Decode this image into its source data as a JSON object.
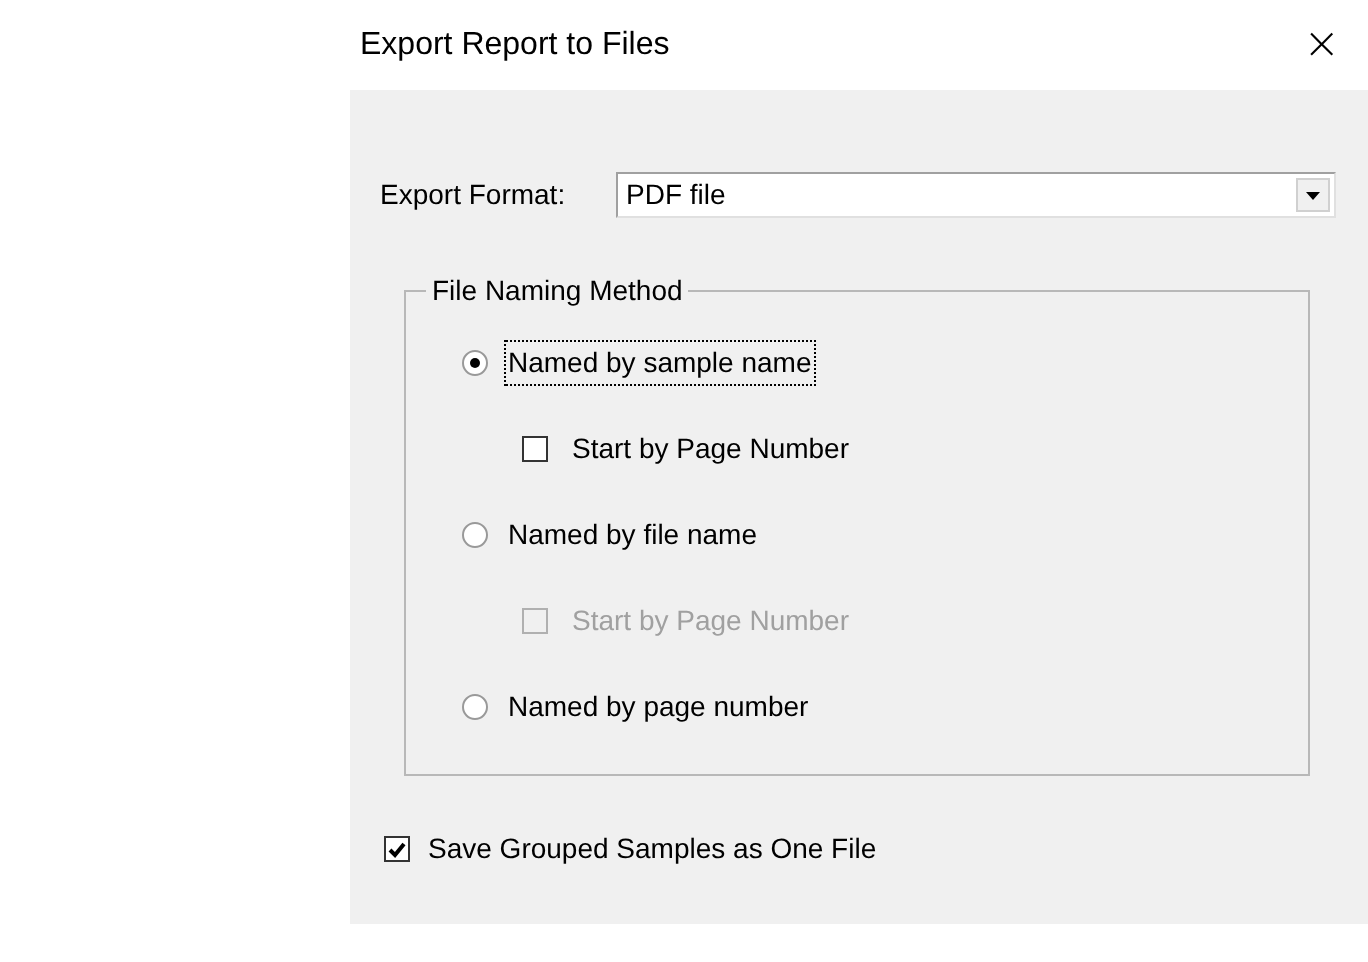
{
  "window": {
    "title": "Export Report to Files",
    "close": "×"
  },
  "export_format": {
    "label": "Export Format:",
    "value": "PDF file"
  },
  "file_naming_method": {
    "title": "File Naming Method",
    "options": [
      {
        "kind": "radio",
        "label": "Named by sample name",
        "selected": true,
        "focused": true,
        "disabled": false
      },
      {
        "kind": "checkbox",
        "label": "Start by Page Number",
        "checked": false,
        "disabled": false
      },
      {
        "kind": "radio",
        "label": "Named by file name",
        "selected": false,
        "focused": false,
        "disabled": false
      },
      {
        "kind": "checkbox",
        "label": "Start by Page Number",
        "checked": false,
        "disabled": true
      },
      {
        "kind": "radio",
        "label": "Named by page number",
        "selected": false,
        "focused": false,
        "disabled": false
      }
    ]
  },
  "save_grouped": {
    "label": "Save Grouped Samples as One File",
    "checked": true
  }
}
